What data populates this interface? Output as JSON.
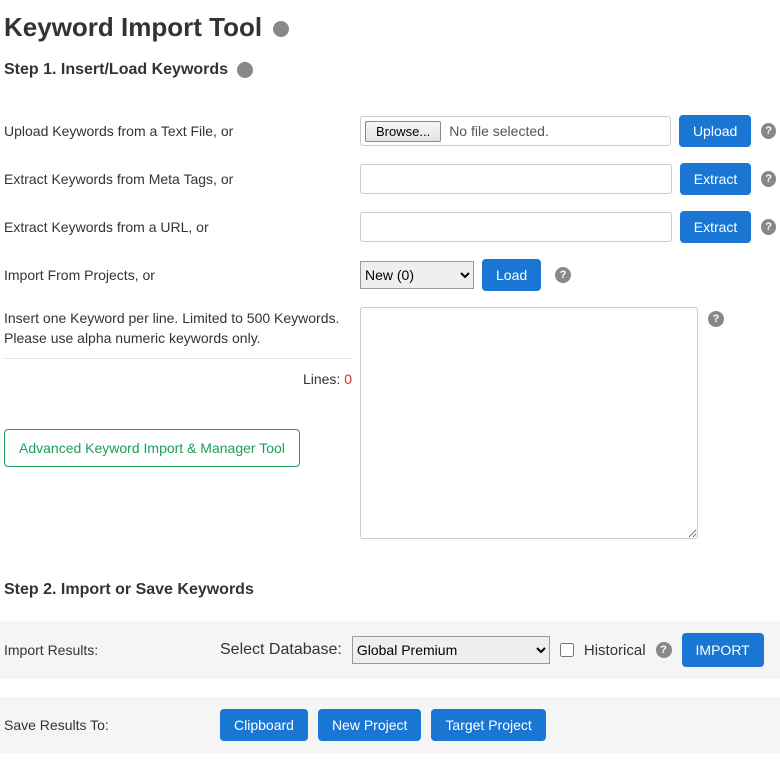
{
  "page": {
    "title": "Keyword Import Tool"
  },
  "step1": {
    "heading": "Step 1. Insert/Load Keywords",
    "upload": {
      "label": "Upload Keywords from a Text File, or",
      "browse_btn": "Browse...",
      "no_file_text": "No file selected.",
      "upload_btn": "Upload"
    },
    "meta": {
      "label": "Extract Keywords from Meta Tags, or",
      "value": "",
      "extract_btn": "Extract"
    },
    "url": {
      "label": "Extract Keywords from a URL, or",
      "value": "",
      "extract_btn": "Extract"
    },
    "projects": {
      "label": "Import From Projects, or",
      "selected": "New (0)",
      "load_btn": "Load"
    },
    "textarea": {
      "label": "Insert one Keyword per line. Limited to 500 Keywords. Please use alpha numeric keywords only.",
      "value": "",
      "lines_label": "Lines: ",
      "lines_count": "0"
    },
    "advanced_btn": "Advanced Keyword Import & Manager Tool"
  },
  "step2": {
    "heading": "Step 2. Import or Save Keywords",
    "import_row": {
      "label": "Import Results:",
      "db_label": "Select Database:",
      "db_selected": "Global Premium",
      "historical_label": "Historical",
      "historical_checked": false,
      "import_btn": "IMPORT"
    },
    "save_row": {
      "label": "Save Results To:",
      "clipboard_btn": "Clipboard",
      "new_project_btn": "New Project",
      "target_project_btn": "Target Project"
    }
  }
}
